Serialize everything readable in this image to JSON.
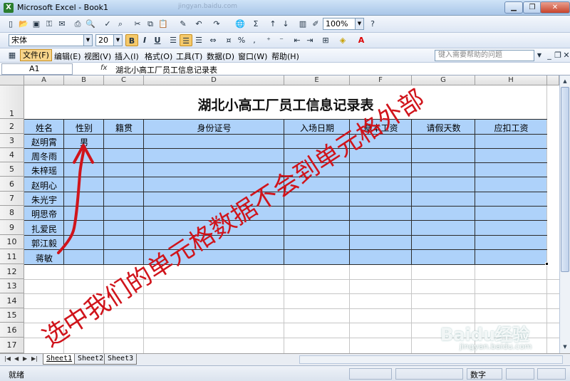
{
  "window": {
    "title": "Microsoft Excel - Book1",
    "url_ghost": "jingyan.baidu.com"
  },
  "toolbar": {
    "font_name": "宋体",
    "font_size": "20",
    "zoom": "100%",
    "bold": "B",
    "italic": "I",
    "underline": "U",
    "percent": "%"
  },
  "menu": {
    "items": [
      "文件(F)",
      "编辑(E)",
      "视图(V)",
      "插入(I)",
      "格式(O)",
      "工具(T)",
      "数据(D)",
      "窗口(W)",
      "帮助(H)"
    ],
    "help_placeholder": "键入需要帮助的问题"
  },
  "formula_bar": {
    "name_box": "A1",
    "fx": "fx",
    "content": "湖北小高工厂员工信息记录表"
  },
  "sheet": {
    "columns": [
      "A",
      "B",
      "C",
      "D",
      "E",
      "F",
      "G",
      "H"
    ],
    "rows": [
      "1",
      "2",
      "3",
      "4",
      "5",
      "6",
      "7",
      "8",
      "9",
      "10",
      "11",
      "12",
      "13",
      "14",
      "15",
      "16",
      "17"
    ],
    "title": "湖北小高工厂员工信息记录表",
    "headers": [
      "姓名",
      "性别",
      "籍贯",
      "身份证号",
      "入场日期",
      "基本工资",
      "请假天数",
      "应扣工资"
    ],
    "names": [
      "赵明霄",
      "周冬雨",
      "朱梓瑶",
      "赵明心",
      "朱光宇",
      "明思帝",
      "扎爱民",
      "郭江毅",
      "蒋敏"
    ],
    "gender_b3": "男"
  },
  "tabs": [
    "Sheet1",
    "Sheet2",
    "Sheet3"
  ],
  "status": {
    "left": "就绪",
    "mode": "数字"
  },
  "annotation": {
    "text": "选中我们的单元格数据不会到单元格外部",
    "color": "#d0141b"
  },
  "watermark": {
    "brand": "Baidu经验",
    "url": "jingyan.baidu.com"
  }
}
